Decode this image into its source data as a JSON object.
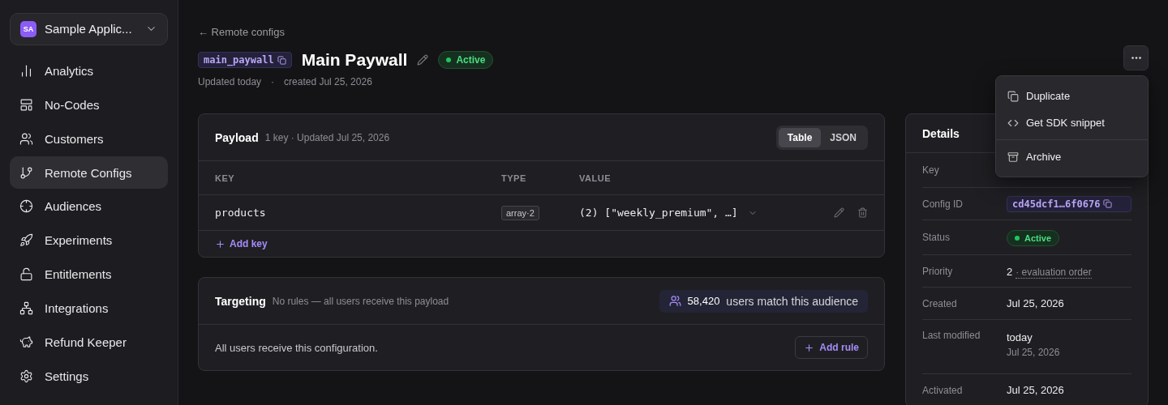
{
  "app_switcher": {
    "initials": "SA",
    "name": "Sample Applic..."
  },
  "sidebar": {
    "items": [
      {
        "label": "Analytics",
        "selected": false
      },
      {
        "label": "No-Codes",
        "selected": false
      },
      {
        "label": "Customers",
        "selected": false
      },
      {
        "label": "Remote Configs",
        "selected": true
      },
      {
        "label": "Audiences",
        "selected": false
      },
      {
        "label": "Experiments",
        "selected": false
      },
      {
        "label": "Entitlements",
        "selected": false
      },
      {
        "label": "Integrations",
        "selected": false
      },
      {
        "label": "Refund Keeper",
        "selected": false
      },
      {
        "label": "Settings",
        "selected": false
      }
    ]
  },
  "breadcrumb": "← Remote configs",
  "header": {
    "key": "main_paywall",
    "title": "Main Paywall",
    "status": "Active",
    "updated": "Updated today",
    "separator": "·",
    "created": "created Jul 25, 2026"
  },
  "payload": {
    "title": "Payload",
    "meta": "1 key · Updated Jul 25, 2026",
    "views": [
      {
        "label": "Table",
        "selected": true
      },
      {
        "label": "JSON",
        "selected": false
      }
    ],
    "columns": [
      "KEY",
      "TYPE",
      "VALUE"
    ],
    "rows": [
      {
        "key": "products",
        "type": "array·2",
        "value": "(2) [\"weekly_premium\", …]"
      }
    ],
    "add_label": "Add key"
  },
  "targeting": {
    "title": "Targeting",
    "meta": "No rules — all users receive this payload",
    "count": "58,420",
    "count_label": "users match this audience",
    "body": "All users receive this configuration.",
    "add_label": "Add rule"
  },
  "details": {
    "title": "Details",
    "rows": [
      {
        "kind": "empty",
        "label": "Key"
      },
      {
        "kind": "code",
        "label": "Config ID",
        "value": "cd45dcf1…6f0676"
      },
      {
        "kind": "status",
        "label": "Status",
        "value": "Active"
      },
      {
        "kind": "priority",
        "label": "Priority",
        "value": "2",
        "note": "· evaluation order"
      },
      {
        "kind": "text",
        "label": "Created",
        "value": "Jul 25, 2026"
      },
      {
        "kind": "dated",
        "label": "Last modified",
        "value": "today",
        "sub": "Jul 25, 2026"
      },
      {
        "kind": "text",
        "label": "Activated",
        "value": "Jul 25, 2026"
      }
    ]
  },
  "menu": {
    "open": true,
    "items": [
      {
        "label": "Duplicate",
        "kind": "item"
      },
      {
        "label": "Get SDK snippet",
        "kind": "item"
      },
      {
        "label": "Archive",
        "kind": "separated"
      }
    ]
  }
}
